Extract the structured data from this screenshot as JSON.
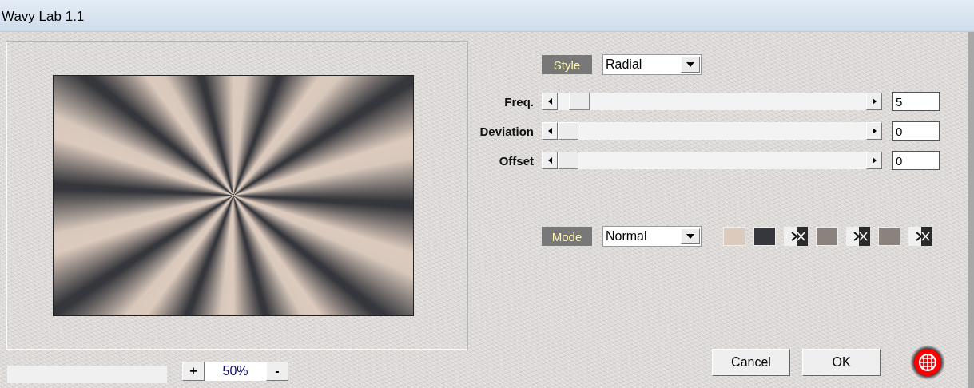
{
  "window": {
    "title": "Wavy Lab 1.1"
  },
  "style": {
    "label": "Style",
    "value": "Radial"
  },
  "sliders": [
    {
      "label": "Freq.",
      "level": 0.04,
      "value": "5"
    },
    {
      "label": "Deviation",
      "level": 0,
      "value": "0"
    },
    {
      "label": "Offset",
      "level": 0,
      "value": "0"
    }
  ],
  "mode": {
    "label": "Mode",
    "value": "Normal"
  },
  "palette": [
    {
      "kind": "swatch",
      "color": "#dccabd"
    },
    {
      "kind": "swatch",
      "color": "#36373c"
    },
    {
      "kind": "swap"
    },
    {
      "kind": "swatch",
      "color": "#8a827d"
    },
    {
      "kind": "swap"
    },
    {
      "kind": "swatch",
      "color": "#8a827d"
    },
    {
      "kind": "swap"
    }
  ],
  "zoom": {
    "increase": "+",
    "value": "50%",
    "decrease": "-"
  },
  "buttons": [
    "Cancel",
    "OK"
  ]
}
